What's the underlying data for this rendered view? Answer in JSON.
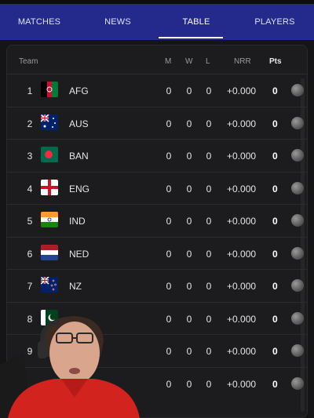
{
  "tabs": [
    {
      "label": "MATCHES",
      "active": false
    },
    {
      "label": "NEWS",
      "active": false
    },
    {
      "label": "TABLE",
      "active": true
    },
    {
      "label": "PLAYERS",
      "active": false
    }
  ],
  "table": {
    "headers": {
      "team": "Team",
      "m": "M",
      "w": "W",
      "l": "L",
      "nrr": "NRR",
      "pts": "Pts"
    },
    "rows": [
      {
        "pos": "1",
        "flag": "afg-flag-icon",
        "code": "AFG",
        "m": "0",
        "w": "0",
        "l": "0",
        "nrr": "+0.000",
        "pts": "0"
      },
      {
        "pos": "2",
        "flag": "aus-flag-icon",
        "code": "AUS",
        "m": "0",
        "w": "0",
        "l": "0",
        "nrr": "+0.000",
        "pts": "0"
      },
      {
        "pos": "3",
        "flag": "ban-flag-icon",
        "code": "BAN",
        "m": "0",
        "w": "0",
        "l": "0",
        "nrr": "+0.000",
        "pts": "0"
      },
      {
        "pos": "4",
        "flag": "eng-flag-icon",
        "code": "ENG",
        "m": "0",
        "w": "0",
        "l": "0",
        "nrr": "+0.000",
        "pts": "0"
      },
      {
        "pos": "5",
        "flag": "ind-flag-icon",
        "code": "IND",
        "m": "0",
        "w": "0",
        "l": "0",
        "nrr": "+0.000",
        "pts": "0"
      },
      {
        "pos": "6",
        "flag": "ned-flag-icon",
        "code": "NED",
        "m": "0",
        "w": "0",
        "l": "0",
        "nrr": "+0.000",
        "pts": "0"
      },
      {
        "pos": "7",
        "flag": "nz-flag-icon",
        "code": "NZ",
        "m": "0",
        "w": "0",
        "l": "0",
        "nrr": "+0.000",
        "pts": "0"
      },
      {
        "pos": "8",
        "flag": "pak-flag-icon",
        "code": "",
        "m": "0",
        "w": "0",
        "l": "0",
        "nrr": "+0.000",
        "pts": "0"
      },
      {
        "pos": "9",
        "flag": "",
        "code": "",
        "m": "0",
        "w": "0",
        "l": "0",
        "nrr": "+0.000",
        "pts": "0"
      },
      {
        "pos": "",
        "flag": "",
        "code": "",
        "m": "0",
        "w": "0",
        "l": "0",
        "nrr": "+0.000",
        "pts": "0"
      }
    ]
  },
  "colors": {
    "tab_bar": "#232a8c",
    "panel": "#1c1c1e",
    "background": "#151515"
  }
}
